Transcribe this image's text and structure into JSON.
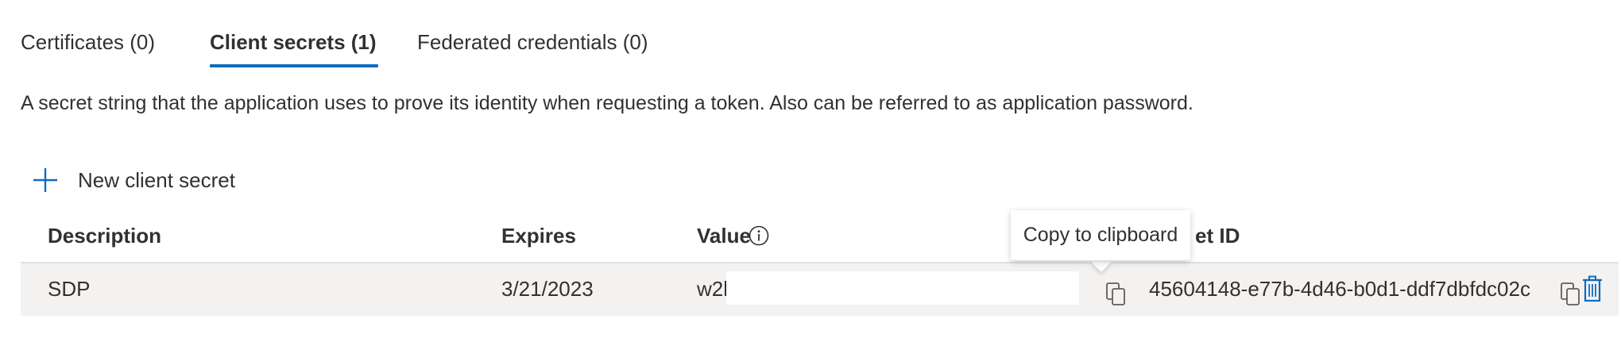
{
  "tabs": [
    {
      "label": "Certificates (0)",
      "active": false
    },
    {
      "label": "Client secrets (1)",
      "active": true
    },
    {
      "label": "Federated credentials (0)",
      "active": false
    }
  ],
  "description": "A secret string that the application uses to prove its identity when requesting a token. Also can be referred to as application password.",
  "toolbar": {
    "new_secret_label": "New client secret"
  },
  "table": {
    "headers": {
      "description": "Description",
      "expires": "Expires",
      "value": "Value",
      "secret_id": "et ID"
    },
    "rows": [
      {
        "description": "SDP",
        "expires": "3/21/2023",
        "value": "w2b",
        "secret_id": "45604148-e77b-4d46-b0d1-ddf7dbfdc02c"
      }
    ]
  },
  "tooltip": {
    "text": "Copy to clipboard"
  },
  "colors": {
    "accent": "#0f6cbd",
    "row_bg": "#f3f2f1",
    "text": "#323130"
  },
  "icons": [
    "plus-icon",
    "info-icon",
    "copy-icon",
    "delete-icon"
  ]
}
